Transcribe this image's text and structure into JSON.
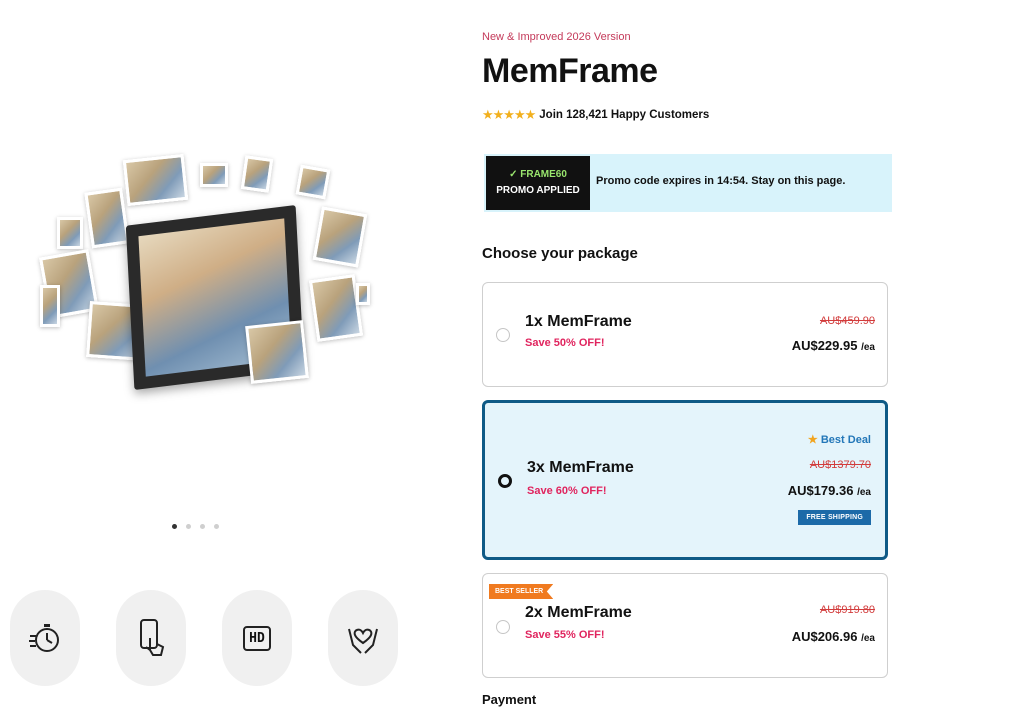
{
  "gallery": {
    "slide_count": 4,
    "active_slide": 1,
    "features": [
      {
        "icon": "stopwatch-icon"
      },
      {
        "icon": "phone-touch-icon"
      },
      {
        "icon": "hd-icon",
        "label": "HD"
      },
      {
        "icon": "hands-heart-icon"
      }
    ]
  },
  "product": {
    "eyebrow": "New & Improved 2026 Version",
    "title": "MemFrame",
    "stars": "★★★★★",
    "rating_text": "Join 128,421 Happy Customers"
  },
  "promo": {
    "code": "✓ FRAME60",
    "status": "PROMO APPLIED",
    "message": "Promo code expires in 14:54. Stay on this page."
  },
  "packages": {
    "heading": "Choose your package",
    "items": [
      {
        "name": "1x MemFrame",
        "save": "Save 50% OFF!",
        "was": "AU$459.90",
        "price": "AU$229.95",
        "unit": "/ea",
        "selected": false
      },
      {
        "name": "3x MemFrame",
        "save": "Save 60% OFF!",
        "was": "AU$1379.70",
        "price": "AU$179.36",
        "unit": "/ea",
        "selected": true,
        "badge": "Best Deal",
        "shipping": "FREE SHIPPING"
      },
      {
        "name": "2x MemFrame",
        "save": "Save 55% OFF!",
        "was": "AU$919.80",
        "price": "AU$206.96",
        "unit": "/ea",
        "selected": false,
        "ribbon": "BEST SELLER"
      }
    ]
  },
  "payment_heading": "Payment",
  "colors": {
    "accent": "#0f5a86",
    "sale_red": "#e0245e",
    "promo_bg": "#d8f3fb",
    "star": "#f2b01e"
  }
}
